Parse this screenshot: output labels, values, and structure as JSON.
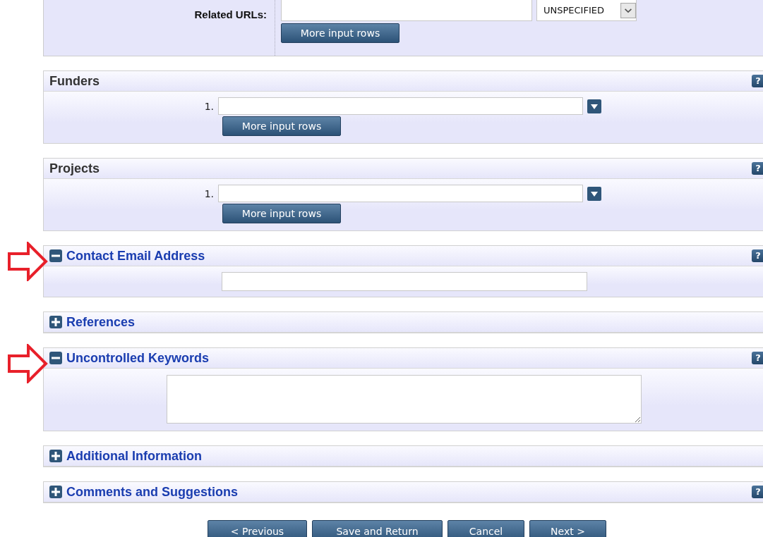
{
  "related_urls": {
    "label": "Related URLs:",
    "select_value": "UNSPECIFIED",
    "button": "More input rows"
  },
  "sections": [
    {
      "kind": "multi",
      "title": "Funders",
      "help": "?",
      "row_number": "1.",
      "button": "More input rows"
    },
    {
      "kind": "multi",
      "title": "Projects",
      "help": "?",
      "row_number": "1.",
      "button": "More input rows"
    },
    {
      "kind": "email",
      "title": "Contact Email Address",
      "help": "?",
      "expanded": true,
      "annotated": true
    },
    {
      "title": "References",
      "expanded": false
    },
    {
      "kind": "textarea",
      "title": "Uncontrolled Keywords",
      "help": "?",
      "expanded": true,
      "annotated": true
    },
    {
      "title": "Additional Information",
      "expanded": false
    },
    {
      "title": "Comments and Suggestions",
      "help": "?",
      "expanded": false
    }
  ],
  "nav_buttons": [
    "< Previous",
    "Save and Return",
    "Cancel",
    "Next >"
  ]
}
